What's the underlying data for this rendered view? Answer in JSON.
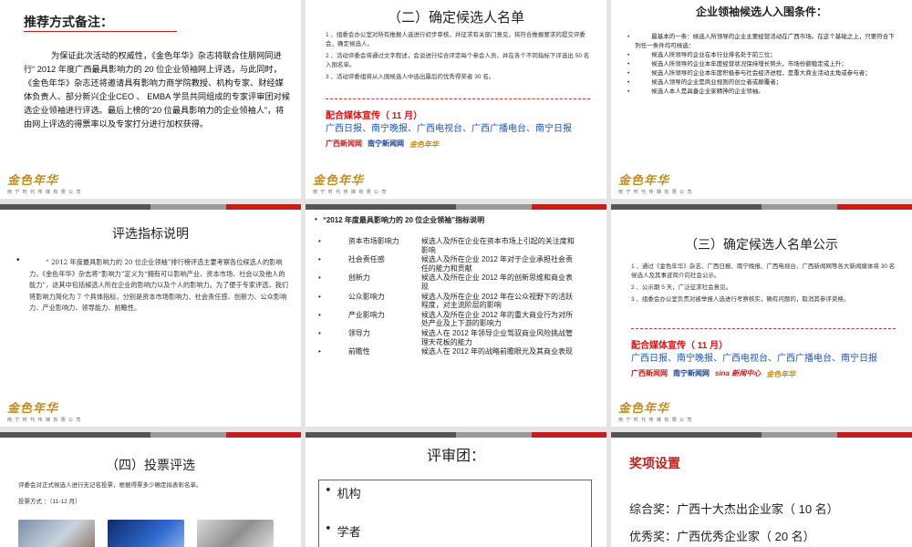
{
  "slide1": {
    "title": "推荐方式备注：",
    "body": "为保证此次活动的权威性，《金色年华》杂志将联合住朋网同进行“ 2012 年度广西最具影响力的 20 位企业领袖网上评选，与此同时，《金色年华》杂志还将邀请具有影响力商学院教授、机构专家、财经媒体负责人、部分新兴企业CEO 、 EMBA 学员共同组成的专家评审团对候选企业领袖进行评选。最后上榜的“20 位最具影响力的企业领袖人”，将由网上评选的得票率以及专家打分进行加权获得。"
  },
  "slide2": {
    "title": "（二）确定候选人名单",
    "items": [
      "1 、组委会办公室对所有推报人选进行初步审核，并征求有关部门意见，将符合推报要求的提交评委会，确定候选人。",
      "2 、活动评委会将通过文字叙述，会谈进行综合评定每个参会人员，并在各个不同指标下评选出 50 名入围名单。",
      "3 、活动评委组将从入围候选人中选出最后的优秀得奖者 30 名。"
    ],
    "media_title": "配合媒体宣传（ 11 月）",
    "media_list": "广西日报、南宁晚报、广西电视台、广西广播电台、南宁日报"
  },
  "slide3": {
    "title": "企业领袖候选人入围条件：",
    "items": [
      "最基本的一条：候选人所领导的企业主要经营活动在广西市场。在这个基础之上，只要符合下列任一条件均可候选：",
      "候选人所领导的企业在本行业排名处于前三位；",
      "候选人所领导的企业本年度经营状况保持增长势头，市场份额稳定或上升；",
      "候选人所领导的企业本年度积极参与社会经济进程，是重大商业活动主角或参与者；",
      "候选人领导的企业是商业规则的创立者或颠覆者；",
      "候选人本人是具备企业家精神的企业领袖。"
    ]
  },
  "slide4": {
    "title": "评选指标说明",
    "body": "“ 2012 年度最具影响力的 20 位企业领袖”排行榜评选主要考察各位候选人的影响力。《金色年华》杂志将“影响力”定义为“拥有可以影响产业、资本市场、社会以及他人的能力”，这其中包括候选人所在企业的影响力以及个人的影响力。为了便于专家评选，我们将影响力简化为 7 个具体指标，分别是资本市场影响力、社会责任感、创新力、公众影响力、产业影响力、领导能力、前瞻性。"
  },
  "slide5": {
    "title": "“2012 年度最具影响力的 20 位企业领袖”指标说明",
    "items": [
      {
        "label": "资本市场影响力",
        "desc": "候选人及所在企业在资本市场上引起的关注度和影响"
      },
      {
        "label": "社会责任感",
        "desc": "候选人及所在企业 2012 年对于企业承担社会责任的能力和贡献"
      },
      {
        "label": "创新力",
        "desc": "候选人及所在企业 2012 年的创新思维和商业表现"
      },
      {
        "label": "公众影响力",
        "desc": "候选人及所在企业 2012 年在公众视野下的活跃程度，对主流阶层的影响"
      },
      {
        "label": "产业影响力",
        "desc": "候选人及所在企业 2012 年的重大商业行为对所处产业及上下游的影响力"
      },
      {
        "label": "领导力",
        "desc": "候选人在 2012 年领导企业驾驭商业风险挑战管理天花板的能力"
      },
      {
        "label": "前瞻性",
        "desc": "候选人在 2012 年的战略前瞻眼光及其商业表现"
      }
    ]
  },
  "slide6": {
    "title": "（三）确定候选人名单公示",
    "items": [
      "1 、通过《金色年华》杂志、广西日报、南宁晚报、广西电视台、广西新闻网等各大新闻媒体将 30 名候选人及其事迹简介向社会公示。",
      "2 、公示期 5 天，广泛征求社会意见。",
      "3 、组委会办公室负责对被举报人选进行考察核实，确有问题的，取消其参评资格。"
    ],
    "media_title": "配合媒体宣传（ 11 月）",
    "media_list": "广西日报、南宁晚报、广西电视台、广西广播电台、南宁日报"
  },
  "slide7": {
    "title": "（四）投票评选",
    "line1": "评委会对正式候选人进行无记名投票，根据得票多少确定拟表彰名单。",
    "line2": "投票方式 ：（11-12 月）"
  },
  "slide8": {
    "title": "评审团：",
    "items": [
      "机构",
      "学者"
    ]
  },
  "slide9": {
    "title": "奖项设置",
    "awards": [
      "综合奖：广西十大杰出企业家（ 10 名）",
      "优秀奖：广西优秀企业家（ 20 名）"
    ]
  },
  "footer": {
    "logo": "金色年华",
    "company": "南 宁 时 代 传 媒 有 限 公 司"
  },
  "media_logos": {
    "gx_news": "广西新闻网",
    "nn_news": "南宁新闻网",
    "sina": "sina 新闻中心",
    "gold": "金色年华"
  },
  "colors": {
    "accent_red": "#c61d1d",
    "media_blue": "#1a55c8",
    "brand_gold": "#c88a18"
  }
}
